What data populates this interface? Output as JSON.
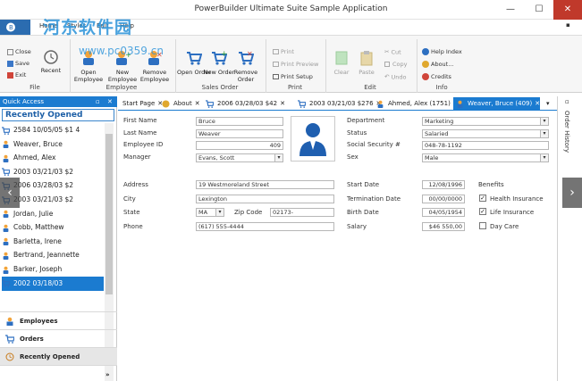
{
  "window": {
    "title": "PowerBuilder Ultimate Suite Sample Application",
    "minimize": "—",
    "maximize": "☐",
    "close": "✕"
  },
  "ribbon_tabs": [
    "Home",
    "Styles",
    "Edit",
    "Help"
  ],
  "ribbon": {
    "file": {
      "label": "File",
      "close": "Close",
      "save": "Save",
      "exit": "Exit",
      "recent": "Recent"
    },
    "employee": {
      "label": "Employee",
      "open": "Open Employee",
      "new": "New Employee",
      "remove": "Remove Employee"
    },
    "sales_order": {
      "label": "Sales Order",
      "open": "Open Order",
      "new": "New Order",
      "remove": "Remove Order"
    },
    "print": {
      "label": "Print",
      "print": "Print",
      "preview": "Print Preview",
      "setup": "Print Setup"
    },
    "edit": {
      "label": "Edit",
      "clear": "Clear",
      "paste": "Paste",
      "cut": "Cut",
      "copy": "Copy",
      "undo": "Undo"
    },
    "info": {
      "label": "Info",
      "help_index": "Help Index",
      "about": "About...",
      "credits": "Credits"
    }
  },
  "quick_access": {
    "header": "Quick Access",
    "pin": "📌",
    "title": "Recently Opened",
    "items": [
      {
        "text": "2584  10/05/05      $1 4",
        "icon": "cart"
      },
      {
        "text": "Weaver, Bruce",
        "icon": "person"
      },
      {
        "text": "Ahmed, Alex",
        "icon": "person"
      },
      {
        "text": "2003  03/21/03       $2",
        "icon": "cart"
      },
      {
        "text": "2006  03/28/03       $2",
        "icon": "cart"
      },
      {
        "text": "2003  03/21/03       $2",
        "icon": "cart"
      },
      {
        "text": "Jordan, Julie",
        "icon": "person"
      },
      {
        "text": "Cobb, Matthew",
        "icon": "person"
      },
      {
        "text": "Barletta, Irene",
        "icon": "person"
      },
      {
        "text": "Bertrand, Jeannette",
        "icon": "person"
      },
      {
        "text": "Barker, Joseph",
        "icon": "person"
      },
      {
        "text": "2002  03/18/03",
        "icon": "cart",
        "selected": true
      }
    ],
    "nav": [
      "Employees",
      "Orders",
      "Recently Opened"
    ]
  },
  "doc_tabs": [
    {
      "label": "Start Page",
      "icon": ""
    },
    {
      "label": "About",
      "icon": "info"
    },
    {
      "label": "2006 03/28/03 $42",
      "icon": "cart"
    },
    {
      "label": "2003 03/21/03 $276",
      "icon": "cart"
    },
    {
      "label": "Ahmed, Alex (1751)",
      "icon": "person"
    },
    {
      "label": "Weaver, Bruce (409)",
      "icon": "person",
      "active": true
    }
  ],
  "form": {
    "first_name": {
      "label": "First Name",
      "value": "Bruce"
    },
    "last_name": {
      "label": "Last Name",
      "value": "Weaver"
    },
    "employee_id": {
      "label": "Employee ID",
      "value": "409"
    },
    "manager": {
      "label": "Manager",
      "value": "Evans, Scott"
    },
    "department": {
      "label": "Department",
      "value": "Marketing"
    },
    "status": {
      "label": "Status",
      "value": "Salaried"
    },
    "ssn": {
      "label": "Social Security #",
      "value": "048-78-1192"
    },
    "sex": {
      "label": "Sex",
      "value": "Male"
    },
    "address": {
      "label": "Address",
      "value": "19 Westmoreland Street"
    },
    "city": {
      "label": "City",
      "value": "Lexington"
    },
    "state": {
      "label": "State",
      "value": "MA"
    },
    "zip": {
      "label": "Zip Code",
      "value": "02173-"
    },
    "phone": {
      "label": "Phone",
      "value": "(617) 555-4444"
    },
    "start_date": {
      "label": "Start Date",
      "value": "12/08/1996"
    },
    "termination_date": {
      "label": "Termination Date",
      "value": "00/00/0000"
    },
    "birth_date": {
      "label": "Birth Date",
      "value": "04/05/1954"
    },
    "salary": {
      "label": "Salary",
      "value": "$46 550,00"
    },
    "benefits": {
      "label": "Benefits",
      "health": "Health Insurance",
      "life": "Life Insurance",
      "daycare": "Day Care",
      "health_checked": true,
      "life_checked": true,
      "daycare_checked": false
    }
  },
  "history_label": "Order History",
  "watermark": {
    "text": "河东软件园",
    "url": "www.pc0359.cn"
  },
  "colors": {
    "accent": "#1b7bd0",
    "close": "#c0392b"
  }
}
